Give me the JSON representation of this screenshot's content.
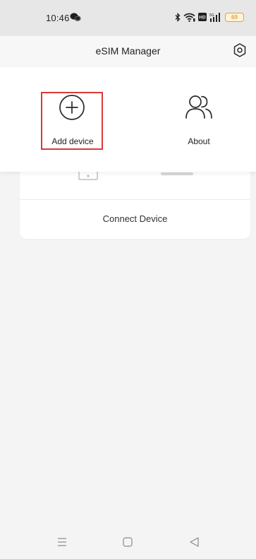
{
  "status_bar": {
    "time": "10:46",
    "battery_level": "69",
    "icons": [
      "wechat-icon",
      "bluetooth-icon",
      "wifi-icon",
      "hd-icon",
      "signal-icon",
      "battery-icon"
    ]
  },
  "header": {
    "title": "eSIM Manager",
    "settings_icon": "gear-icon"
  },
  "popup_menu": {
    "items": [
      {
        "label": "Add device",
        "icon": "plus-circle-icon",
        "highlighted": true
      },
      {
        "label": "About",
        "icon": "users-icon",
        "highlighted": false
      }
    ]
  },
  "device_card": {
    "connect_label": "Connect Device"
  },
  "nav_bar": {
    "icons": [
      "menu-icon",
      "home-icon",
      "back-icon"
    ]
  },
  "colors": {
    "highlight_border": "#d93a3a",
    "battery": "#e8a23a",
    "background": "#f4f4f5"
  }
}
